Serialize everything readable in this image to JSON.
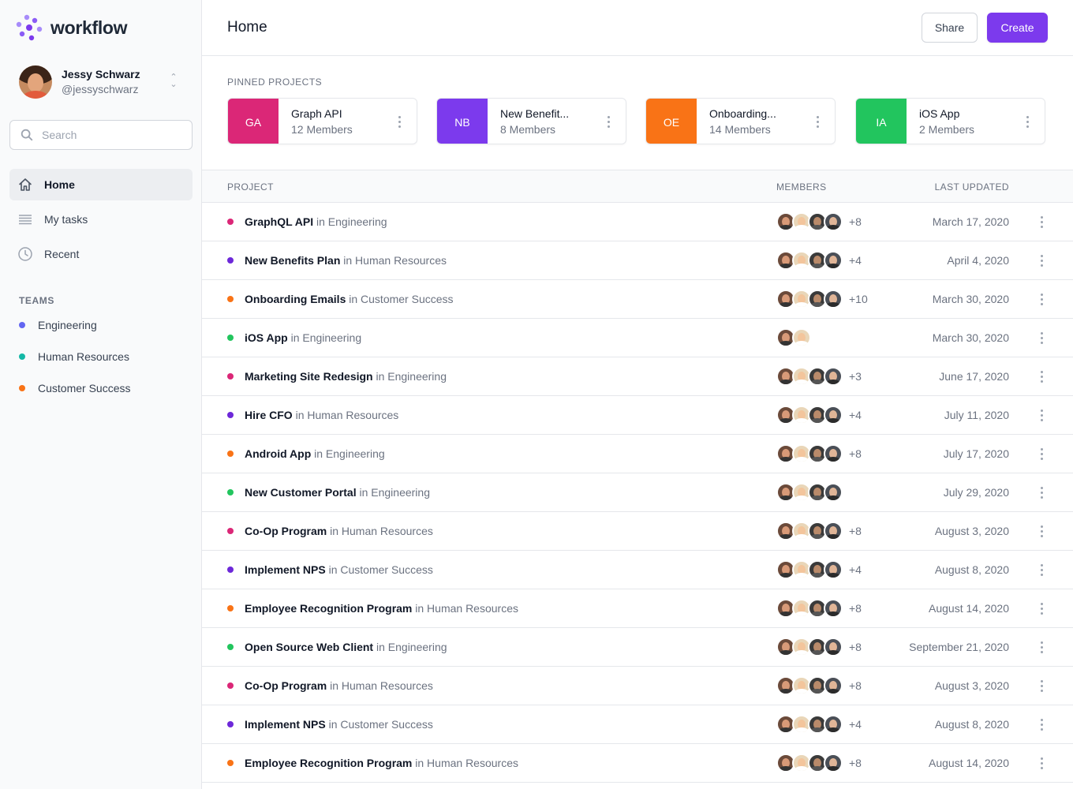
{
  "brand": {
    "name": "workflow",
    "accent": "#7c3aed"
  },
  "user": {
    "name": "Jessy Schwarz",
    "handle": "@jessyschwarz"
  },
  "search": {
    "placeholder": "Search"
  },
  "nav": [
    {
      "label": "Home",
      "icon": "home-icon",
      "active": true
    },
    {
      "label": "My tasks",
      "icon": "list-icon",
      "active": false
    },
    {
      "label": "Recent",
      "icon": "clock-icon",
      "active": false
    }
  ],
  "teams": {
    "title": "TEAMS",
    "items": [
      {
        "label": "Engineering",
        "color": "#6366f1"
      },
      {
        "label": "Human Resources",
        "color": "#14b8a6"
      },
      {
        "label": "Customer Success",
        "color": "#f97316"
      }
    ]
  },
  "header": {
    "title": "Home",
    "share_label": "Share",
    "create_label": "Create"
  },
  "pinned": {
    "title": "PINNED PROJECTS",
    "items": [
      {
        "initials": "GA",
        "name": "Graph API",
        "members": "12 Members",
        "color": "#db2777"
      },
      {
        "initials": "NB",
        "name": "New Benefit...",
        "members": "8 Members",
        "color": "#7c3aed"
      },
      {
        "initials": "OE",
        "name": "Onboarding...",
        "members": "14 Members",
        "color": "#f97316"
      },
      {
        "initials": "IA",
        "name": "iOS App",
        "members": "2 Members",
        "color": "#22c55e"
      }
    ]
  },
  "table": {
    "headers": {
      "project": "PROJECT",
      "members": "MEMBERS",
      "updated": "LAST UPDATED"
    },
    "rows": [
      {
        "name": "GraphQL API",
        "team": "in Engineering",
        "dot": "#db2777",
        "avatars": 4,
        "more": "+8",
        "updated": "March 17, 2020"
      },
      {
        "name": "New Benefits Plan",
        "team": "in Human Resources",
        "dot": "#6d28d9",
        "avatars": 4,
        "more": "+4",
        "updated": "April 4, 2020"
      },
      {
        "name": "Onboarding Emails",
        "team": "in Customer Success",
        "dot": "#f97316",
        "avatars": 4,
        "more": "+10",
        "updated": "March 30, 2020"
      },
      {
        "name": "iOS App",
        "team": "in Engineering",
        "dot": "#22c55e",
        "avatars": 2,
        "more": "",
        "updated": "March 30, 2020"
      },
      {
        "name": "Marketing Site Redesign",
        "team": "in Engineering",
        "dot": "#db2777",
        "avatars": 4,
        "more": "+3",
        "updated": "June 17, 2020"
      },
      {
        "name": "Hire CFO",
        "team": "in Human Resources",
        "dot": "#6d28d9",
        "avatars": 4,
        "more": "+4",
        "updated": "July 11, 2020"
      },
      {
        "name": "Android App",
        "team": "in Engineering",
        "dot": "#f97316",
        "avatars": 4,
        "more": "+8",
        "updated": "July 17, 2020"
      },
      {
        "name": "New Customer Portal",
        "team": "in Engineering",
        "dot": "#22c55e",
        "avatars": 4,
        "more": "",
        "updated": "July 29, 2020"
      },
      {
        "name": "Co-Op Program",
        "team": "in Human Resources",
        "dot": "#db2777",
        "avatars": 4,
        "more": "+8",
        "updated": "August 3, 2020"
      },
      {
        "name": "Implement NPS",
        "team": "in Customer Success",
        "dot": "#6d28d9",
        "avatars": 4,
        "more": "+4",
        "updated": "August 8, 2020"
      },
      {
        "name": "Employee Recognition Program",
        "team": "in Human Resources",
        "dot": "#f97316",
        "avatars": 4,
        "more": "+8",
        "updated": "August 14, 2020"
      },
      {
        "name": "Open Source Web Client",
        "team": "in Engineering",
        "dot": "#22c55e",
        "avatars": 4,
        "more": "+8",
        "updated": "September 21, 2020"
      },
      {
        "name": "Co-Op Program",
        "team": "in Human Resources",
        "dot": "#db2777",
        "avatars": 4,
        "more": "+8",
        "updated": "August 3, 2020"
      },
      {
        "name": "Implement NPS",
        "team": "in Customer Success",
        "dot": "#6d28d9",
        "avatars": 4,
        "more": "+4",
        "updated": "August 8, 2020"
      },
      {
        "name": "Employee Recognition Program",
        "team": "in Human Resources",
        "dot": "#f97316",
        "avatars": 4,
        "more": "+8",
        "updated": "August 14, 2020"
      }
    ]
  }
}
